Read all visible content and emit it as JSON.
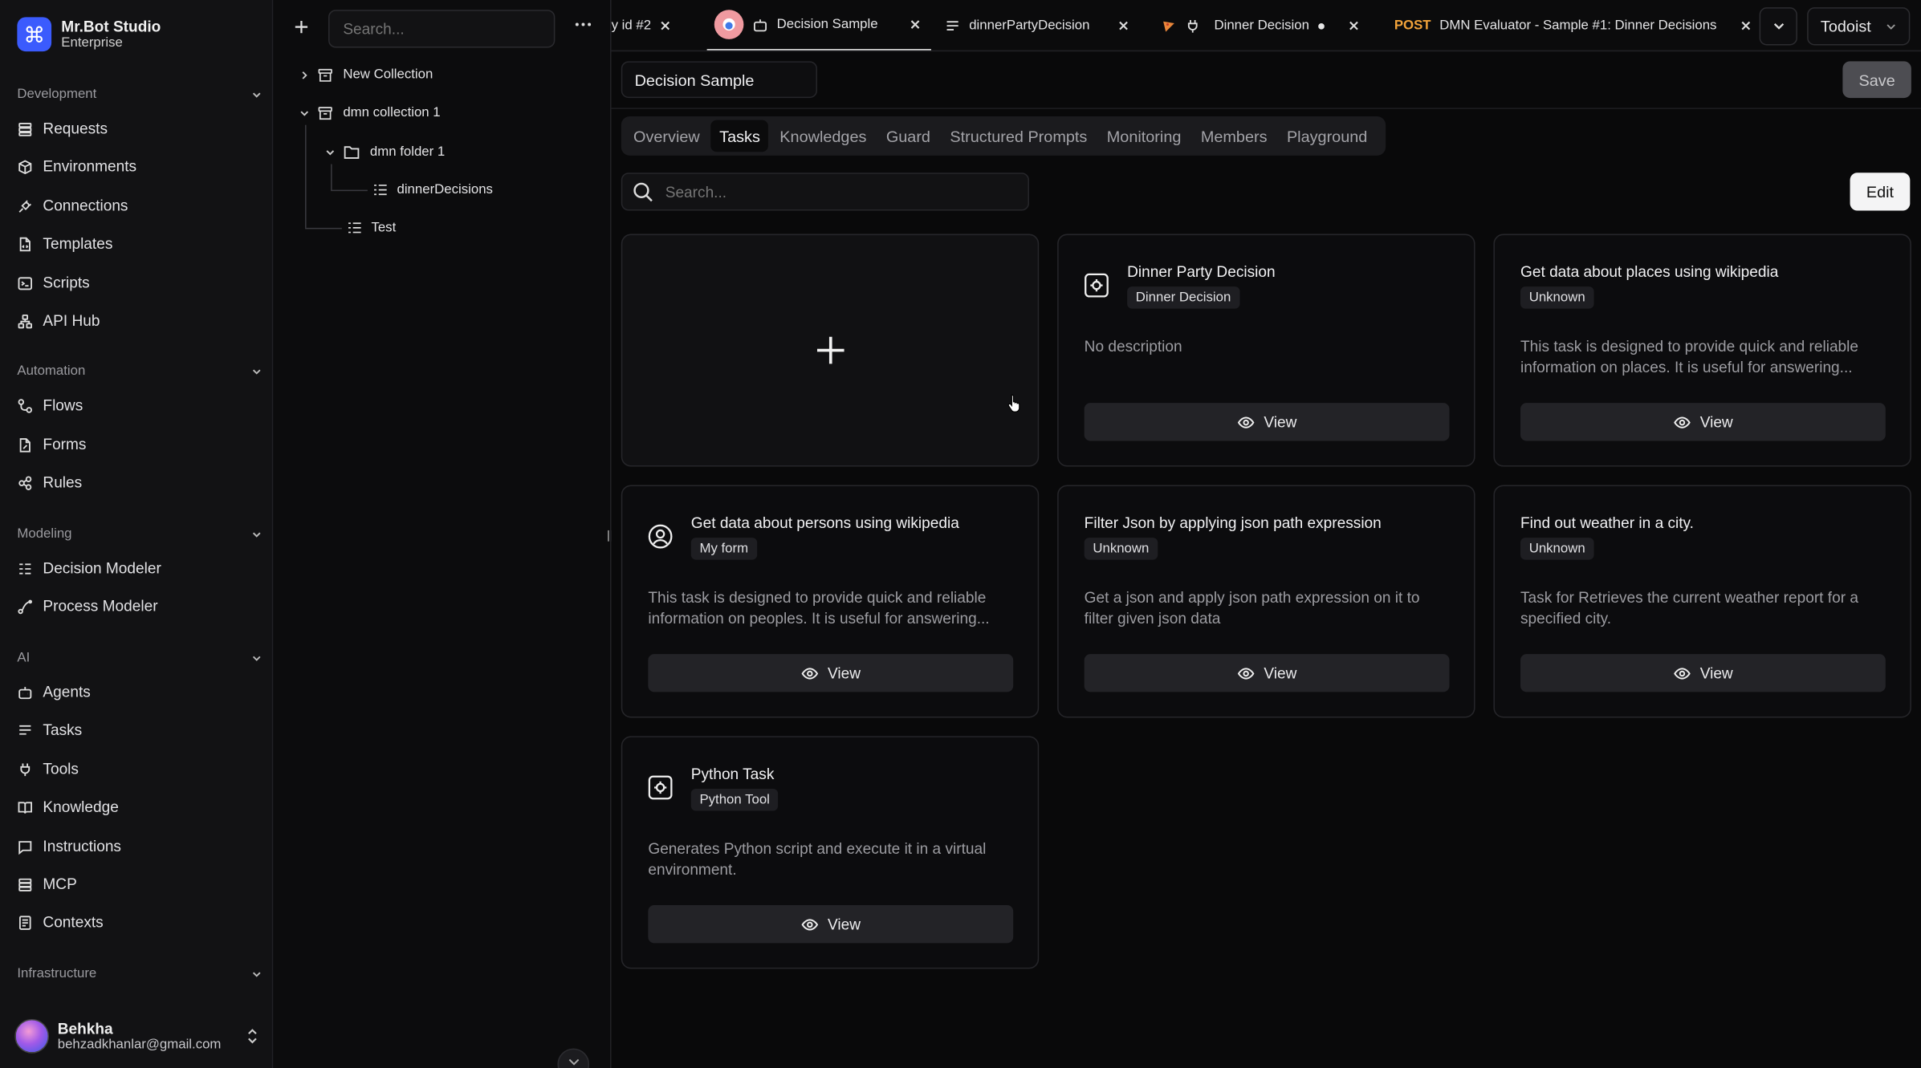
{
  "brand": {
    "name": "Mr.Bot Studio",
    "plan": "Enterprise"
  },
  "sidebar": {
    "sections": [
      {
        "label": "Development",
        "items": [
          {
            "label": "Requests",
            "icon": "layers-icon"
          },
          {
            "label": "Environments",
            "icon": "box-icon"
          },
          {
            "label": "Connections",
            "icon": "plug-icon"
          },
          {
            "label": "Templates",
            "icon": "file-code-icon"
          },
          {
            "label": "Scripts",
            "icon": "terminal-icon"
          },
          {
            "label": "API Hub",
            "icon": "network-icon"
          }
        ]
      },
      {
        "label": "Automation",
        "items": [
          {
            "label": "Flows",
            "icon": "flow-icon"
          },
          {
            "label": "Forms",
            "icon": "form-icon"
          },
          {
            "label": "Rules",
            "icon": "rules-icon"
          }
        ]
      },
      {
        "label": "Modeling",
        "items": [
          {
            "label": "Decision Modeler",
            "icon": "decision-icon"
          },
          {
            "label": "Process Modeler",
            "icon": "process-icon"
          }
        ]
      },
      {
        "label": "AI",
        "items": [
          {
            "label": "Agents",
            "icon": "bot-icon"
          },
          {
            "label": "Tasks",
            "icon": "list-icon"
          },
          {
            "label": "Tools",
            "icon": "plug-icon"
          },
          {
            "label": "Knowledge",
            "icon": "book-icon"
          },
          {
            "label": "Instructions",
            "icon": "message-icon"
          },
          {
            "label": "MCP",
            "icon": "server-icon"
          },
          {
            "label": "Contexts",
            "icon": "document-icon"
          }
        ]
      },
      {
        "label": "Infrastructure",
        "items": []
      }
    ],
    "user": {
      "name": "Behkha",
      "email": "behzadkhanlar@gmail.com"
    }
  },
  "collections": {
    "search_placeholder": "Search...",
    "tree": [
      {
        "label": "New Collection"
      },
      {
        "label": "dmn collection 1"
      },
      {
        "label": "dmn folder 1"
      },
      {
        "label": "dinnerDecisions"
      },
      {
        "label": "Test"
      }
    ]
  },
  "tabs": [
    {
      "label": "y id #2"
    },
    {
      "label": "Decision Sample"
    },
    {
      "label": "dinnerPartyDecision"
    },
    {
      "label": "Dinner Decision"
    },
    {
      "method": "POST",
      "label": "DMN Evaluator - Sample #1: Dinner Decisions"
    }
  ],
  "workspace": "Todoist",
  "header": {
    "title": "Decision Sample",
    "save_label": "Save"
  },
  "subtabs": [
    "Overview",
    "Tasks",
    "Knowledges",
    "Guard",
    "Structured Prompts",
    "Monitoring",
    "Members",
    "Playground"
  ],
  "toolbar": {
    "search_placeholder": "Search...",
    "edit_label": "Edit"
  },
  "cards": [
    {
      "title": "Dinner Party Decision",
      "tag": "Dinner Decision",
      "description": "No description",
      "icon": "gear-box-icon",
      "view_label": "View"
    },
    {
      "title": "Get data about places using wikipedia",
      "tag": "Unknown",
      "description": "This task is designed to provide quick and reliable information on places. It is useful for answering...",
      "icon": "",
      "view_label": "View"
    },
    {
      "title": "Get data about persons using wikipedia",
      "tag": "My form",
      "description": "This task is designed to provide quick and reliable information on peoples. It is useful for answering...",
      "icon": "user-circle-icon",
      "view_label": "View"
    },
    {
      "title": "Filter Json by applying json path expression",
      "tag": "Unknown",
      "description": "Get a json and apply json path expression on it to filter given json data",
      "icon": "",
      "view_label": "View"
    },
    {
      "title": "Find out weather in a city.",
      "tag": "Unknown",
      "description": "Task for Retrieves the current weather report for a specified city.",
      "icon": "",
      "view_label": "View"
    },
    {
      "title": "Python Task",
      "tag": "Python Tool",
      "description": "Generates Python script and execute it in a virtual environment.",
      "icon": "gear-box-icon",
      "view_label": "View"
    }
  ],
  "colors": {
    "accent": "#3b5bfd",
    "post_method": "#f2a33a",
    "tab_badge": "#ef9aa0"
  }
}
